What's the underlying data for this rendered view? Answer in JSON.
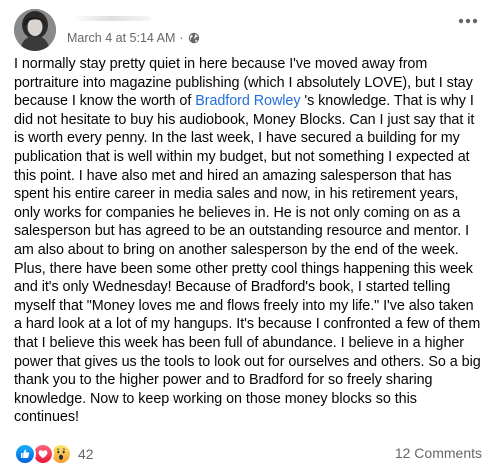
{
  "post": {
    "author_name": "",
    "timestamp": "March 4 at 5:14 AM",
    "separator": "·",
    "audience_icon": "globe-icon",
    "more_icon": "more-horizontal-icon",
    "text": {
      "part1": "I normally stay pretty quiet in here because I've moved away from portraiture into magazine publishing (which I absolutely LOVE), but I stay because I know the worth of ",
      "mention": "Bradford Rowley",
      "part2": " 's knowledge. That is why I did not hesitate to buy his audiobook, Money Blocks. Can I just say that it is worth every penny. In the last week, I have secured a building for my publication that is well within my budget, but not something I expected at this point. I have also met and hired an amazing salesperson that has spent his entire career in media sales and now, in his retirement years, only works for companies he believes in. He is not only coming on as a salesperson but has agreed to be an outstanding resource and mentor. I am also about to bring on another salesperson by the end of the week. Plus, there have been some other pretty cool things happening this week and it's only Wednesday! Because of Bradford's book, I started telling myself that \"Money loves me and flows freely into my life.\" I've also taken a hard look at a lot of my hangups. It's because I confronted a few of them that I believe this week has been full of abundance. I believe in a higher power that gives us the tools to look out for ourselves and others. So a big thank you to the higher power and to Bradford for so freely sharing knowledge. Now to keep working on those money blocks so this continues!"
    },
    "reactions": {
      "icons": [
        "like-icon",
        "love-icon",
        "wow-icon"
      ],
      "count": "42"
    },
    "comments_label": "12 Comments"
  },
  "colors": {
    "mention": "#216fdb",
    "meta_text": "#65676b",
    "like_blue": "#1b74e4",
    "love_red": "#f33e58",
    "wow_yellow": "#fcd060"
  }
}
